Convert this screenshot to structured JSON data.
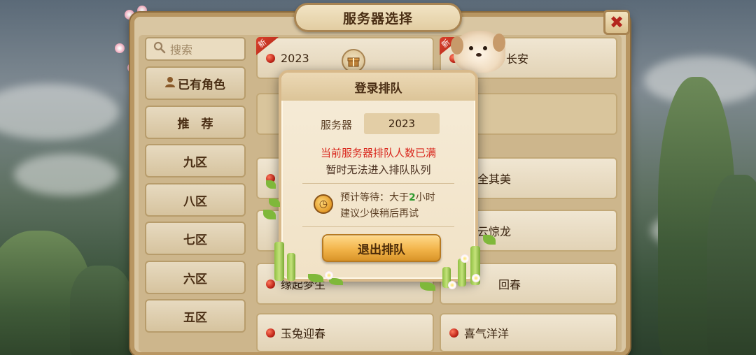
{
  "window": {
    "title": "服务器选择",
    "close_glyph": "✖"
  },
  "sidebar": {
    "search": {
      "placeholder": "搜索",
      "icon": "search-icon"
    },
    "items": [
      {
        "label": "已有角色",
        "icon": "user-icon"
      },
      {
        "label": "推　荐"
      },
      {
        "label": "九区"
      },
      {
        "label": "八区"
      },
      {
        "label": "七区"
      },
      {
        "label": "六区"
      },
      {
        "label": "五区"
      }
    ]
  },
  "servers": [
    {
      "name": "2023",
      "new": true,
      "new_label": "新",
      "gift_icon": "gift-icon"
    },
    {
      "name": "长安",
      "new": true,
      "new_label": "新"
    },
    {
      "name": "全其美"
    },
    {
      "name": "云惊龙"
    },
    {
      "name": "缘起梦生"
    },
    {
      "name": "回春"
    },
    {
      "name": "玉兔迎春"
    },
    {
      "name": "喜气洋洋"
    }
  ],
  "modal": {
    "title": "登录排队",
    "server_label": "服务器",
    "server_value": "2023",
    "warning_line1": "当前服务器排队人数已满",
    "warning_line2": "暂时无法进入排队队列",
    "wait_prefix": "预计等待：大于",
    "wait_hours": "2",
    "wait_suffix": "小时",
    "suggestion": "建议少侠稍后再试",
    "exit_button": "退出排队"
  },
  "colors": {
    "warning_red": "#d9281e",
    "wait_green": "#2e9a2e",
    "button_gold": "#f2b44a"
  }
}
